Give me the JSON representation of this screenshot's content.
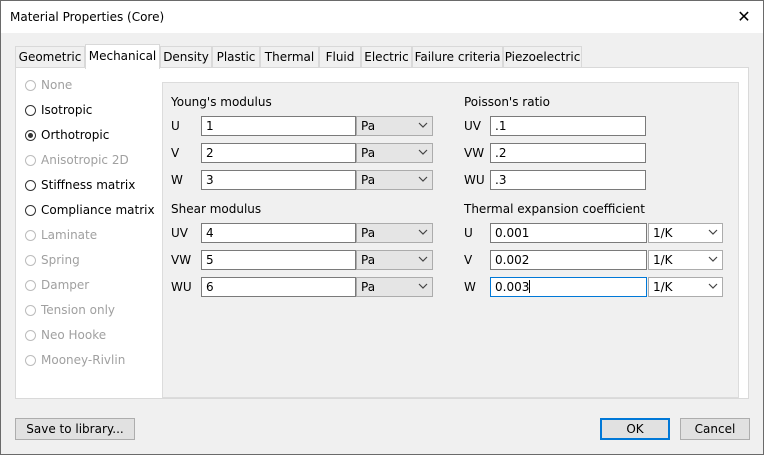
{
  "window": {
    "title": "Material Properties (Core)",
    "close_glyph": "✕"
  },
  "tabs": [
    {
      "label": "Geometric"
    },
    {
      "label": "Mechanical",
      "active": true
    },
    {
      "label": "Density"
    },
    {
      "label": "Plastic"
    },
    {
      "label": "Thermal"
    },
    {
      "label": "Fluid"
    },
    {
      "label": "Electric"
    },
    {
      "label": "Failure criteria"
    },
    {
      "label": "Piezoelectric"
    }
  ],
  "model_options": [
    {
      "label": "None",
      "enabled": false,
      "selected": false
    },
    {
      "label": "Isotropic",
      "enabled": true,
      "selected": false
    },
    {
      "label": "Orthotropic",
      "enabled": true,
      "selected": true
    },
    {
      "label": "Anisotropic 2D",
      "enabled": false,
      "selected": false
    },
    {
      "label": "Stiffness matrix",
      "enabled": true,
      "selected": false
    },
    {
      "label": "Compliance matrix",
      "enabled": true,
      "selected": false
    },
    {
      "label": "Laminate",
      "enabled": false,
      "selected": false
    },
    {
      "label": "Spring",
      "enabled": false,
      "selected": false
    },
    {
      "label": "Damper",
      "enabled": false,
      "selected": false
    },
    {
      "label": "Tension only",
      "enabled": false,
      "selected": false
    },
    {
      "label": "Neo Hooke",
      "enabled": false,
      "selected": false
    },
    {
      "label": "Mooney-Rivlin",
      "enabled": false,
      "selected": false
    }
  ],
  "youngs_modulus": {
    "heading": "Young's modulus",
    "rows": [
      {
        "label": "U",
        "value": "1",
        "unit": "Pa"
      },
      {
        "label": "V",
        "value": "2",
        "unit": "Pa"
      },
      {
        "label": "W",
        "value": "3",
        "unit": "Pa"
      }
    ]
  },
  "shear_modulus": {
    "heading": "Shear modulus",
    "rows": [
      {
        "label": "UV",
        "value": "4",
        "unit": "Pa"
      },
      {
        "label": "VW",
        "value": "5",
        "unit": "Pa"
      },
      {
        "label": "WU",
        "value": "6",
        "unit": "Pa"
      }
    ]
  },
  "poissons_ratio": {
    "heading": "Poisson's ratio",
    "rows": [
      {
        "label": "UV",
        "value": ".1"
      },
      {
        "label": "VW",
        "value": ".2"
      },
      {
        "label": "WU",
        "value": ".3"
      }
    ]
  },
  "thermal_expansion": {
    "heading": "Thermal expansion coefficient",
    "rows": [
      {
        "label": "U",
        "value": "0.001",
        "unit": "1/K"
      },
      {
        "label": "V",
        "value": "0.002",
        "unit": "1/K"
      },
      {
        "label": "W",
        "value": "0.003",
        "unit": "1/K",
        "focused": true
      }
    ]
  },
  "buttons": {
    "save_to_library": "Save to library...",
    "ok": "OK",
    "cancel": "Cancel"
  },
  "colors": {
    "focus": "#0078d7",
    "disabled_text": "#a0a0a0"
  }
}
